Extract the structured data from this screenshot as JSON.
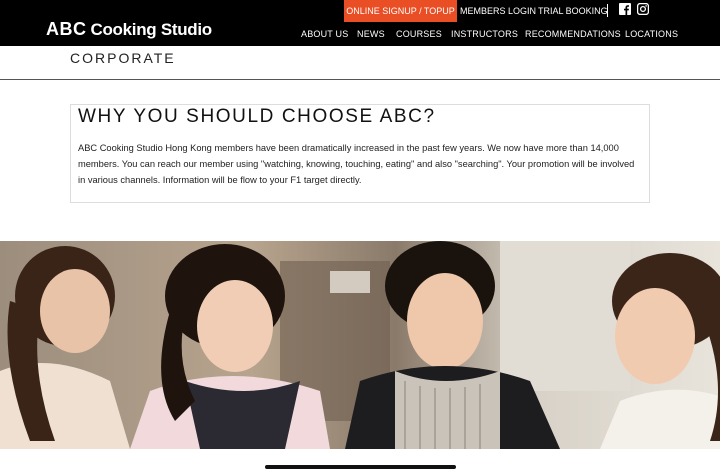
{
  "brand": {
    "logo_abc": "ABC",
    "logo_rest": "Cooking Studio"
  },
  "topbar": {
    "signup": "ONLINE SIGNUP / TOPUP",
    "members_login": "MEMBERS LOGIN",
    "trial_booking": "TRIAL BOOKING",
    "social_icons": [
      "facebook-icon",
      "instagram-icon"
    ]
  },
  "nav": {
    "items": [
      "ABOUT US",
      "NEWS",
      "COURSES",
      "INSTRUCTORS",
      "RECOMMENDATIONS",
      "LOCATIONS"
    ]
  },
  "page": {
    "title": "CORPORATE"
  },
  "content": {
    "heading": "WHY YOU SHOULD CHOOSE ABC?",
    "paragraph": "ABC Cooking Studio Hong Kong members have been dramatically increased in the past few years. We now have more than 14,000 members. You can reach our member using \"watching, knowing, touching, eating\" and also \"searching\". Your promotion will be involved in various channels. Information will be flow to your F1 target directly."
  },
  "colors": {
    "header_bg": "#000000",
    "accent": "#e94e25",
    "text": "#222222"
  }
}
